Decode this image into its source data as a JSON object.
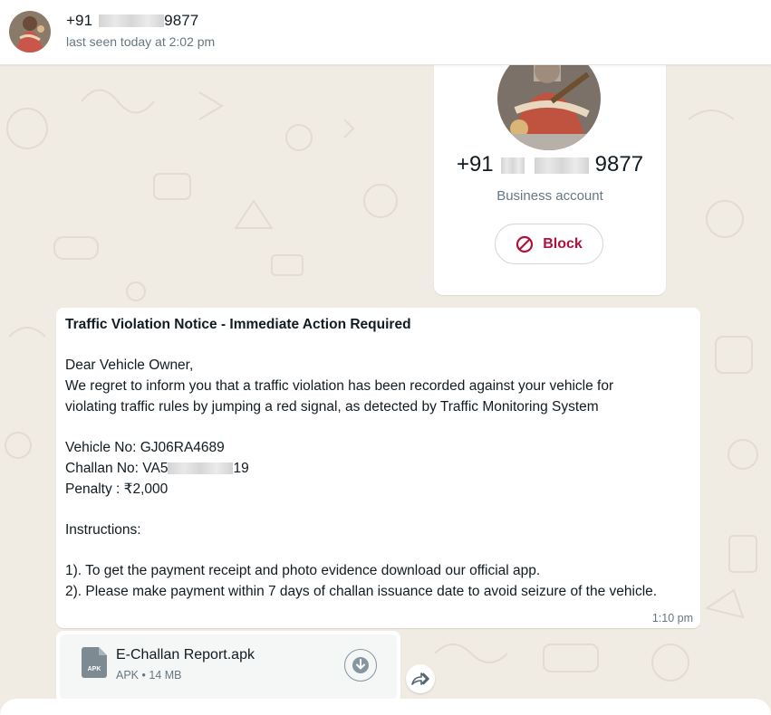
{
  "header": {
    "name_prefix": "+91",
    "name_suffix": "9877",
    "status": "last seen today at 2:02 pm"
  },
  "profile_card": {
    "phone_prefix": "+91",
    "phone_suffix": "9877",
    "account_type": "Business account",
    "block_label": "Block",
    "accent": "#b1123c"
  },
  "message": {
    "title": "Traffic Violation Notice - Immediate Action Required",
    "greeting": "Dear Vehicle Owner,",
    "body_line1": "We regret to inform you that a traffic violation has been recorded against your vehicle for",
    "body_line2": "violating traffic rules by jumping a red signal, as detected by Traffic Monitoring System",
    "vehicle": "Vehicle No: GJ06RA4689",
    "challan_prefix": "Challan No: VA5",
    "challan_suffix": "19",
    "penalty": "Penalty : ₹2,000",
    "instructions_heading": "Instructions:",
    "instruction1": "1). To get the payment receipt and photo evidence download our official app.",
    "instruction2": "2). Please make payment within 7 days of challan issuance date to avoid seizure of the vehicle.",
    "time": "1:10 pm"
  },
  "attachment": {
    "filename": "E-Challan Report.apk",
    "icon_label": "APK",
    "type": "APK",
    "separator": "•",
    "size": "14 MB"
  },
  "icons": {
    "block": "block-icon",
    "download": "download-icon",
    "forward": "forward-icon",
    "file": "file-apk-icon"
  }
}
